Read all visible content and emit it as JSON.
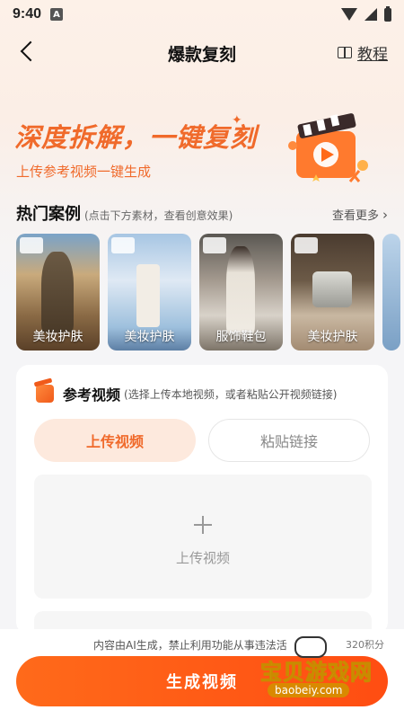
{
  "status": {
    "time": "9:40",
    "notif": "A"
  },
  "nav": {
    "title": "爆款复刻",
    "tutorial": "教程"
  },
  "hero": {
    "title": "深度拆解，一键复刻",
    "subtitle": "上传参考视频一键生成"
  },
  "cases_section": {
    "title": "热门案例",
    "hint": "(点击下方素材，查看创意效果)",
    "more": "查看更多",
    "items": [
      {
        "label": "美妆护肤"
      },
      {
        "label": "美妆护肤"
      },
      {
        "label": "服饰鞋包"
      },
      {
        "label": "美妆护肤"
      }
    ]
  },
  "reference": {
    "title": "参考视频",
    "hint": "(选择上传本地视频，或者粘贴公开视频链接)",
    "tab_upload": "上传视频",
    "tab_paste": "粘贴链接",
    "upload_label": "上传视频"
  },
  "footer": {
    "disclaimer": "内容由AI生成，禁止利用功能从事违法活",
    "points": "320积分",
    "generate": "生成视频"
  },
  "watermark": {
    "text": "宝贝游戏网",
    "url": "baobeiy.com"
  },
  "colors": {
    "accent": "#f06a2b",
    "button": "#ff5a16"
  }
}
